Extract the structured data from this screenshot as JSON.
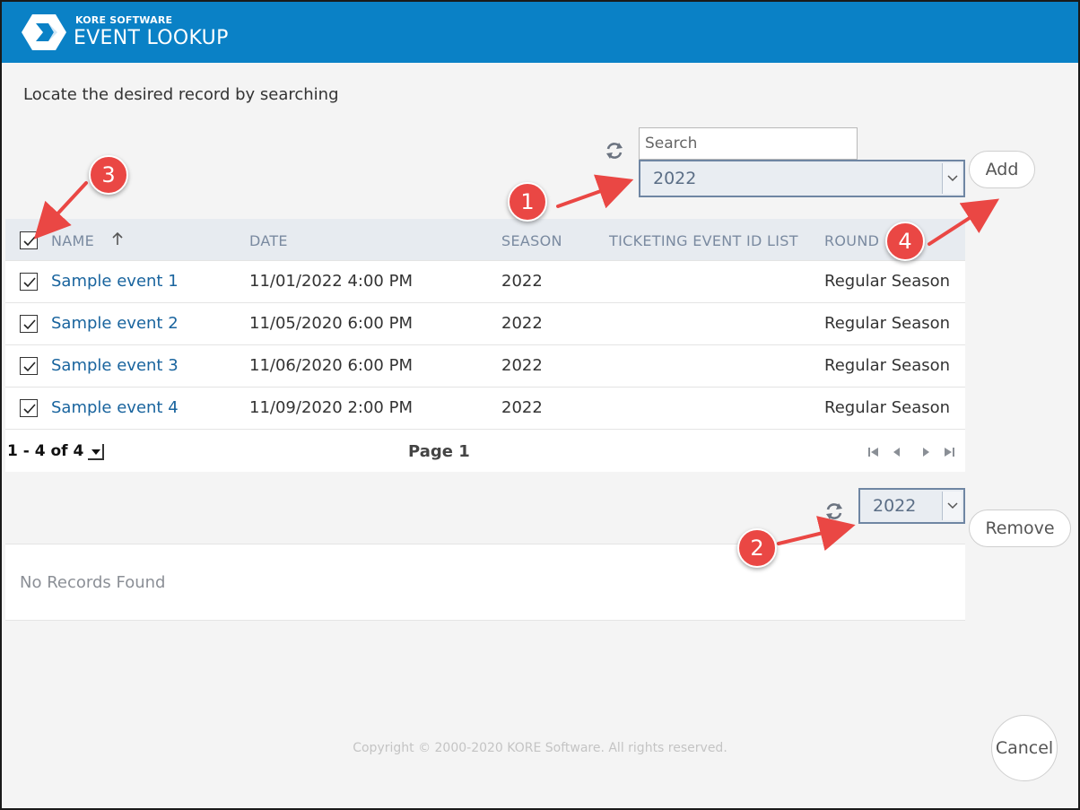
{
  "header": {
    "brand": "KORE SOFTWARE",
    "title": "EVENT LOOKUP"
  },
  "instruction": "Locate the desired record by searching",
  "search": {
    "placeholder": "Search",
    "season_value": "2022"
  },
  "buttons": {
    "add": "Add",
    "remove": "Remove",
    "cancel": "Cancel"
  },
  "grid": {
    "columns": [
      "NAME",
      "DATE",
      "SEASON",
      "TICKETING EVENT ID LIST",
      "ROUND"
    ],
    "sort_column": "NAME",
    "rows": [
      {
        "name": "Sample event 1",
        "date": "11/01/2022 4:00 PM",
        "season": "2022",
        "ticketing": "",
        "round": "Regular Season"
      },
      {
        "name": "Sample event 2",
        "date": "11/05/2020 6:00 PM",
        "season": "2022",
        "ticketing": "",
        "round": "Regular Season"
      },
      {
        "name": "Sample event 3",
        "date": "11/06/2020 6:00 PM",
        "season": "2022",
        "ticketing": "",
        "round": "Regular Season"
      },
      {
        "name": "Sample event 4",
        "date": "11/09/2020 2:00 PM",
        "season": "2022",
        "ticketing": "",
        "round": "Regular Season"
      }
    ],
    "pager": {
      "count": "1 - 4 of 4",
      "page": "Page 1"
    }
  },
  "selected": {
    "season_value": "2022",
    "empty_text": "No Records Found"
  },
  "footer": {
    "copyright": "Copyright © 2000-2020 KORE Software. All rights reserved."
  },
  "annotations": [
    "1",
    "2",
    "3",
    "4"
  ],
  "colors": {
    "header": "#0a81c6",
    "link": "#19649e",
    "badge": "#ea4744"
  },
  "icons": [
    "kore-logo-icon",
    "refresh-icon",
    "chevron-down-icon",
    "checkbox-checked-icon",
    "sort-up-icon",
    "first-page-icon",
    "prev-page-icon",
    "next-page-icon",
    "last-page-icon"
  ]
}
